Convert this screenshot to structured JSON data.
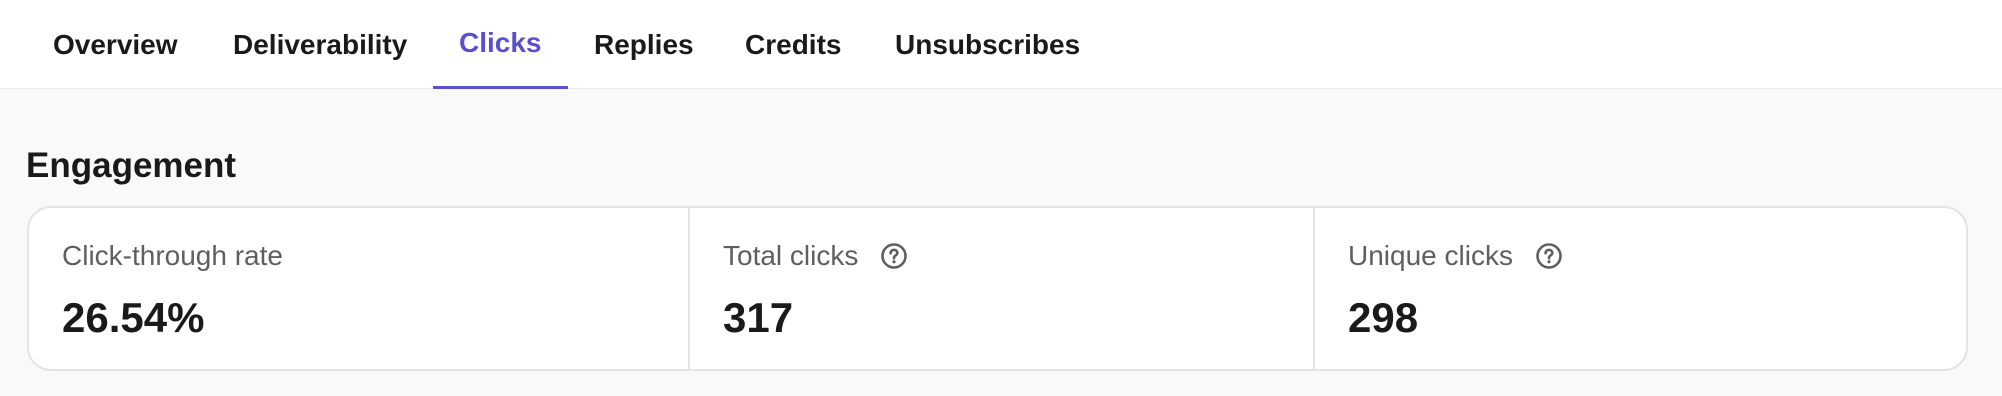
{
  "tabs": [
    {
      "label": "Overview",
      "active": false
    },
    {
      "label": "Deliverability",
      "active": false
    },
    {
      "label": "Clicks",
      "active": true
    },
    {
      "label": "Replies",
      "active": false
    },
    {
      "label": "Credits",
      "active": false
    },
    {
      "label": "Unsubscribes",
      "active": false
    }
  ],
  "section": {
    "title": "Engagement"
  },
  "stats": [
    {
      "label": "Click-through rate",
      "value": "26.54%",
      "icon": null
    },
    {
      "label": "Total clicks",
      "value": "317",
      "icon": "help-circle-icon"
    },
    {
      "label": "Unique clicks",
      "value": "298",
      "icon": "help-circle-icon"
    }
  ],
  "colors": {
    "accent": "#5b4fd1",
    "text": "#1a1a1a",
    "muted": "#5f5f5f",
    "border": "#e4e4e4",
    "background": "#f9f9f9"
  }
}
